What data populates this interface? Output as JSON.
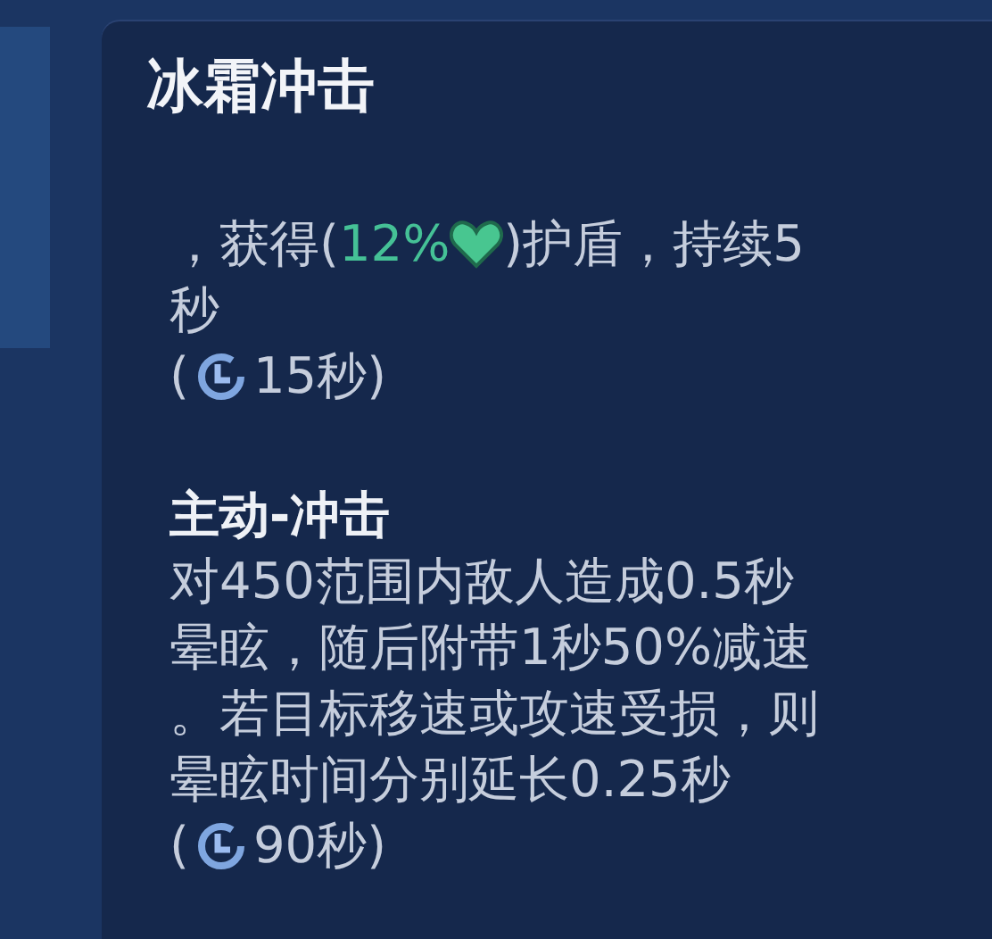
{
  "title": "冰霜冲击",
  "sections": [
    {
      "lines": [
        {
          "before": "，获得(",
          "value": "12%",
          "after": ")护盾，持续5"
        },
        {
          "before": "秒"
        }
      ],
      "cooldown": {
        "open": "(",
        "time": "15秒)"
      }
    },
    {
      "heading": "主动-冲击",
      "lines": [
        {
          "before": "对450范围内敌人造成0.5秒"
        },
        {
          "before": "晕眩，随后附带1秒50%减速"
        },
        {
          "before": "。若目标移速或攻速受损，则"
        },
        {
          "before": "晕眩时间分别延长0.25秒"
        }
      ],
      "cooldown": {
        "open": "(",
        "time": "90秒)"
      }
    }
  ]
}
